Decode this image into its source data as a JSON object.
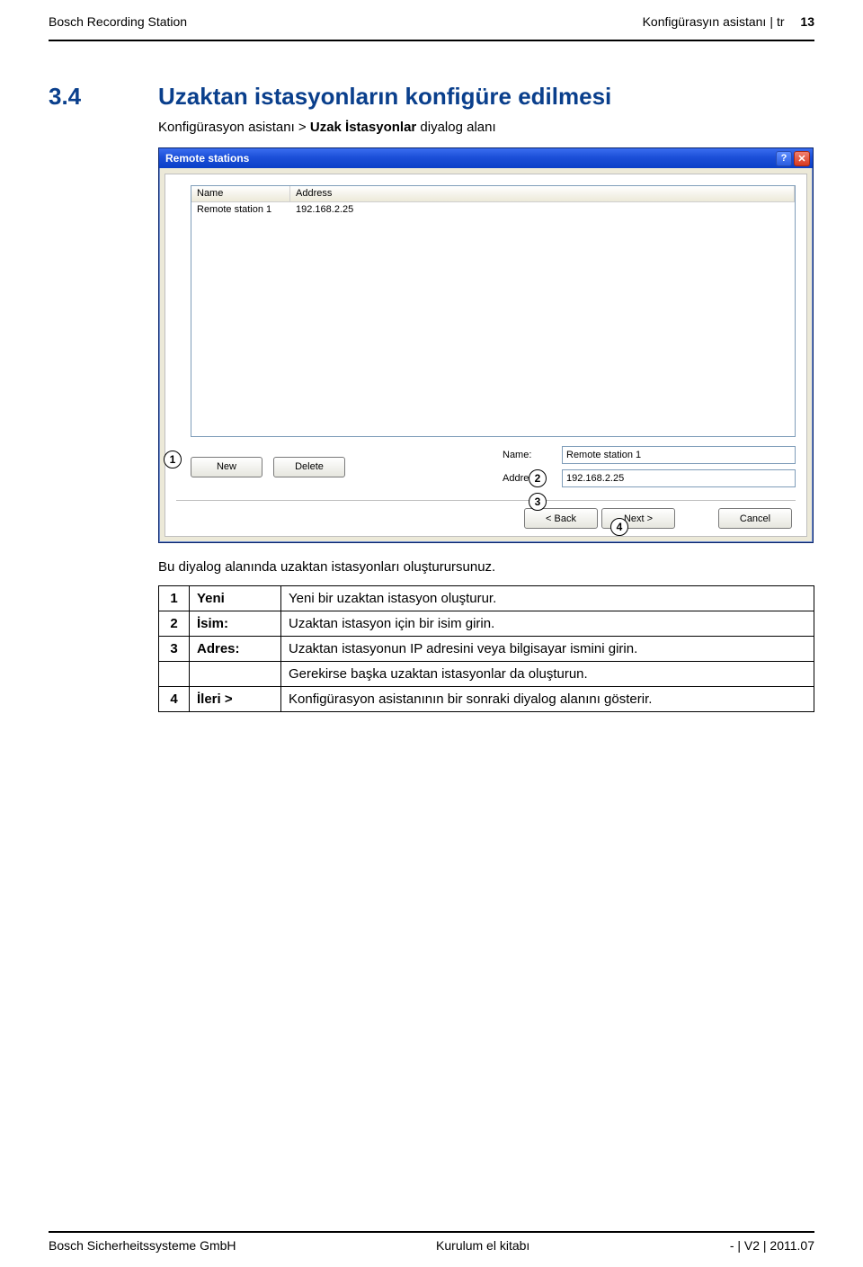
{
  "header": {
    "left": "Bosch Recording Station",
    "right_text": "Konfigürasyın asistanı",
    "right_lang": "tr",
    "page_num": "13"
  },
  "section": {
    "number": "3.4",
    "title": "Uzaktan istasyonların konfigüre edilmesi",
    "subtitle_prefix": "Konfigürasyon asistanı > ",
    "subtitle_bold": "Uzak İstasyonlar",
    "subtitle_suffix": " diyalog alanı"
  },
  "dialog": {
    "title": "Remote stations",
    "help_label": "?",
    "close_label": "✕",
    "columns": {
      "name": "Name",
      "address": "Address"
    },
    "row": {
      "name": "Remote station 1",
      "address": "192.168.2.25"
    },
    "buttons": {
      "new": "New",
      "delete": "Delete"
    },
    "fields": {
      "name_label": "Name:",
      "name_value": "Remote station 1",
      "address_label": "Address:",
      "address_value": "192.168.2.25"
    },
    "nav": {
      "back": "< Back",
      "next": "Next >",
      "cancel": "Cancel"
    }
  },
  "callouts": {
    "c1": "1",
    "c2": "2",
    "c3": "3",
    "c4": "4"
  },
  "description": "Bu diyalog alanında uzaktan istasyonları oluşturursunuz.",
  "legend": [
    {
      "n": "1",
      "k": "Yeni",
      "d": "Yeni bir uzaktan istasyon oluşturur."
    },
    {
      "n": "2",
      "k": "İsim:",
      "d": "Uzaktan istasyon için bir isim girin."
    },
    {
      "n": "3",
      "k": "Adres:",
      "d": "Uzaktan istasyonun IP adresini veya bilgisayar ismini girin."
    },
    {
      "n": "",
      "k": "",
      "d": "Gerekirse başka uzaktan istasyonlar da oluşturun."
    },
    {
      "n": "4",
      "k": "İleri >",
      "d": "Konfigürasyon asistanının bir sonraki diyalog alanını gösterir."
    }
  ],
  "footer": {
    "left": "Bosch Sicherheitssysteme GmbH",
    "center": "Kurulum el kitabı",
    "right": "- | V2 | 2011.07"
  }
}
